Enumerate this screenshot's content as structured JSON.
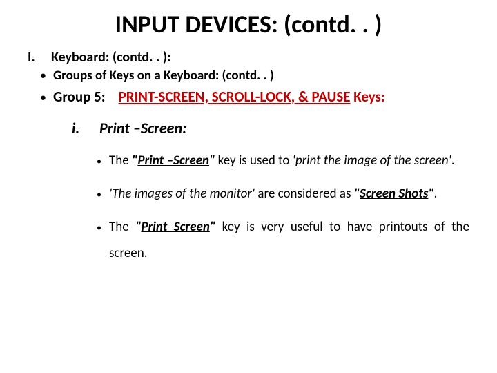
{
  "title": "INPUT DEVICES: (contd. . )",
  "outline": {
    "roman": "I.",
    "heading": "Keyboard: (contd. . ):",
    "sub1": "Groups of Keys on a Keyboard: (contd. . )",
    "group5_label": "Group 5:",
    "group5_body_pre": "PRINT-SCREEN, SCROLL-LOCK, & PAUSE",
    "group5_body_post": " Keys:"
  },
  "item": {
    "num": "i.",
    "title": "Print –Screen:"
  },
  "p1": {
    "pre": "The ",
    "q_open": "\"",
    "q_text": "Print –Screen",
    "q_close": "\"",
    "mid": " key is used to ",
    "ital": "'print the image of the screen'",
    "end": "."
  },
  "p2": {
    "ital_lead": "'The images of the monitor'",
    "mid": " are considered as ",
    "q_open": "\"",
    "q_text": "Screen Shots",
    "q_close": "\"",
    "end": "."
  },
  "p3": {
    "pre": "The ",
    "q_open": "\"",
    "q_text": "Print Screen",
    "q_close": "\"",
    "rest": " key is very useful to have printouts of the screen."
  }
}
